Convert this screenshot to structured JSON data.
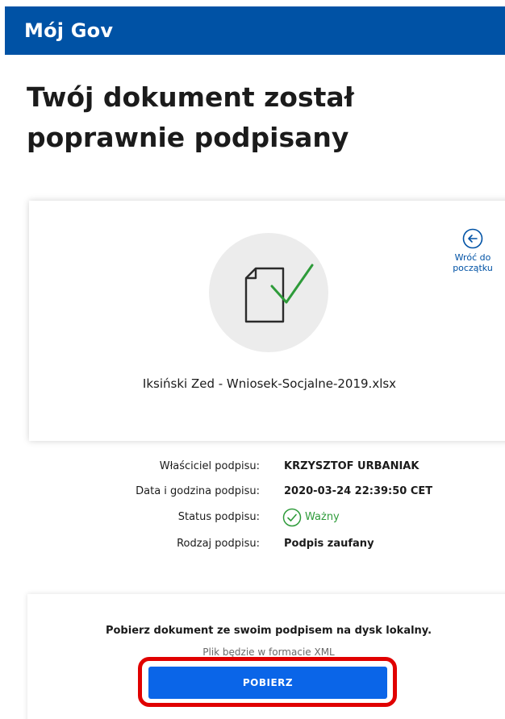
{
  "header": {
    "brand": "Mój Gov"
  },
  "page": {
    "title": "Twój dokument został poprawnie podpisany"
  },
  "card": {
    "filename": "Iksiński Zed - Wniosek-Socjalne-2019.xlsx",
    "back_link": {
      "line1": "Wróć do",
      "line2": "początku",
      "icon": "arrow-left-circle-icon"
    },
    "doc_icon": "document-check-icon",
    "colors": {
      "check": "#2e9b3a",
      "circle": "#ececec"
    }
  },
  "signature": {
    "owner_label": "Właściciel podpisu:",
    "owner_value": "KRZYSZTOF URBANIAK",
    "datetime_label": "Data i godzina podpisu:",
    "datetime_value": "2020-03-24 22:39:50 CET",
    "status_label": "Status podpisu:",
    "status_value": "Ważny",
    "type_label": "Rodzaj podpisu:",
    "type_value": "Podpis zaufany"
  },
  "download": {
    "title": "Pobierz dokument ze swoim podpisem na dysk lokalny.",
    "subtitle": "Plik będzie w formacie XML",
    "button_label": "POBIERZ"
  },
  "colors": {
    "brand": "#0052a5",
    "button": "#0a65e8",
    "highlight": "#e00000",
    "valid": "#2e9b3a"
  }
}
